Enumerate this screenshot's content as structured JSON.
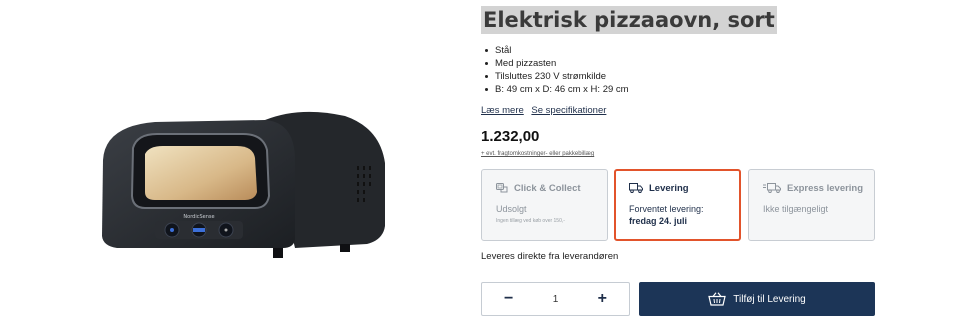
{
  "product": {
    "title": "Elektrisk pizzaaovn, sort",
    "brand_on_image": "NordicSense",
    "features": [
      "Stål",
      "Med pizzasten",
      "Tilsluttes 230 V strømkilde",
      "B: 49 cm x D: 46 cm x H: 29 cm"
    ],
    "read_more": "Læs mere",
    "specs_link": "Se specifikationer",
    "price": "1.232,00",
    "extra_costs": "+ evt. fragtomkostninger- eller pakkebillæg"
  },
  "delivery_options": [
    {
      "label": "Click & Collect",
      "line1": "Udsolgt",
      "line2": "Ingen tillæg ved køb over 150,-",
      "icon": "click-collect-icon"
    },
    {
      "label": "Levering",
      "line1": "Forventet levering:",
      "line2": "fredag 24. juli",
      "icon": "truck-icon",
      "selected": true
    },
    {
      "label": "Express levering",
      "line1": "Ikke tilgængeligt",
      "line2": "",
      "icon": "express-truck-icon"
    }
  ],
  "supplier_note": "Leveres direkte fra leverandøren",
  "quantity": {
    "minus": "−",
    "value": "1",
    "plus": "+"
  },
  "add_button": {
    "label": "Tilføj til Levering",
    "icon": "basket-icon"
  },
  "colors": {
    "accent": "#e2532b",
    "primary": "#1c3557",
    "title_highlight": "#d3d3d3"
  }
}
